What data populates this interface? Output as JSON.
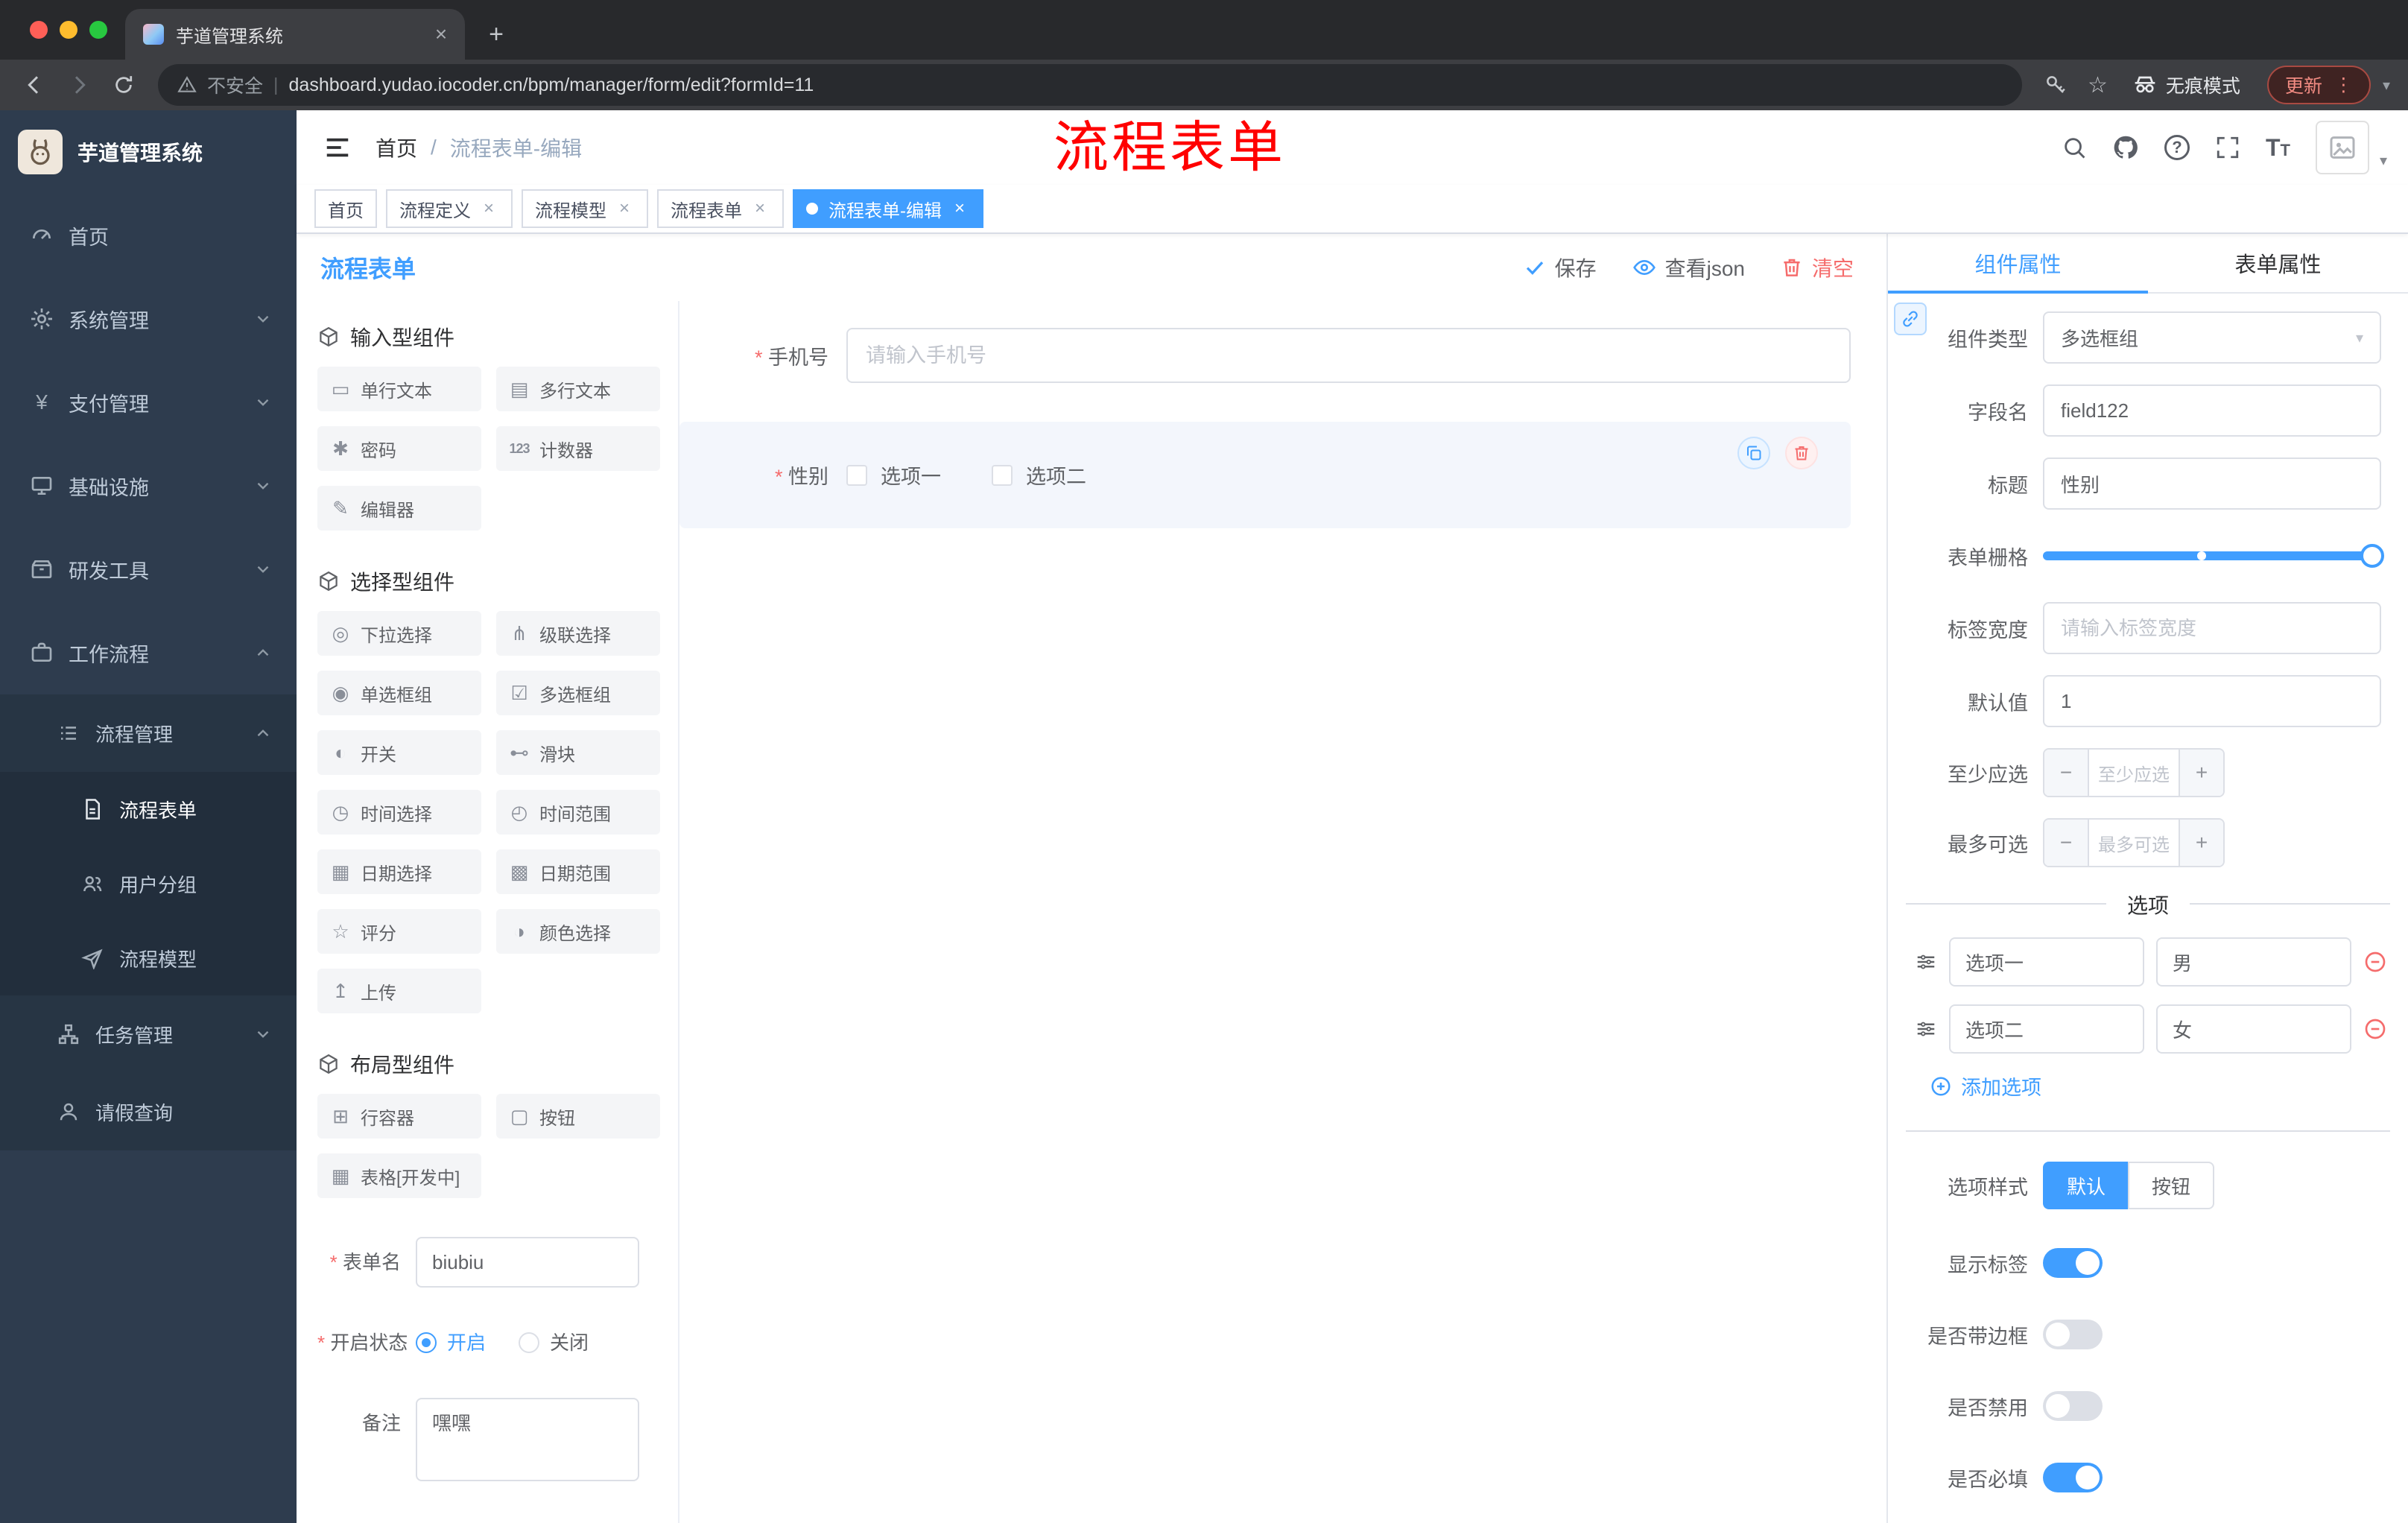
{
  "colors": {
    "accent": "#409eff",
    "danger": "#f56c6c",
    "annotation_red": "#ff0000",
    "sidebar_bg": "#2e3c4e",
    "active_tag_bg": "#409eff"
  },
  "glyphs": {
    "close": "×",
    "plus": "+",
    "minus": "−",
    "dots": "⋮",
    "slash": "/",
    "pipe": "|",
    "star": "☆",
    "caret_down": "▾"
  },
  "browser": {
    "tab_title": "芋道管理系统",
    "security_label": "不安全",
    "url": "dashboard.yudao.iocoder.cn/bpm/manager/form/edit?formId=11",
    "incognito_label": "无痕模式",
    "update_label": "更新"
  },
  "sidebar": {
    "app_title": "芋道管理系统",
    "items": [
      {
        "label": "首页"
      },
      {
        "label": "系统管理"
      },
      {
        "label": "支付管理"
      },
      {
        "label": "基础设施"
      },
      {
        "label": "研发工具"
      },
      {
        "label": "工作流程"
      },
      {
        "label": "流程管理"
      },
      {
        "label": "流程表单"
      },
      {
        "label": "用户分组"
      },
      {
        "label": "流程模型"
      },
      {
        "label": "任务管理"
      },
      {
        "label": "请假查询"
      }
    ]
  },
  "header": {
    "breadcrumb_home": "首页",
    "breadcrumb_current": "流程表单-编辑"
  },
  "annotation": "流程表单",
  "tags": {
    "items": [
      {
        "label": "首页"
      },
      {
        "label": "流程定义"
      },
      {
        "label": "流程模型"
      },
      {
        "label": "流程表单"
      },
      {
        "label": "流程表单-编辑"
      }
    ]
  },
  "designer": {
    "title": "流程表单",
    "toolbar": {
      "save": "保存",
      "view_json": "查看json",
      "clear": "清空"
    },
    "palette": {
      "sections": [
        {
          "title": "输入型组件",
          "items": [
            {
              "icon": "▭",
              "label": "单行文本"
            },
            {
              "icon": "▤",
              "label": "多行文本"
            },
            {
              "icon": "✱",
              "label": "密码"
            },
            {
              "icon": "123",
              "label": "计数器"
            },
            {
              "icon": "✎",
              "label": "编辑器"
            }
          ]
        },
        {
          "title": "选择型组件",
          "items": [
            {
              "icon": "◎",
              "label": "下拉选择"
            },
            {
              "icon": "⋔",
              "label": "级联选择"
            },
            {
              "icon": "◉",
              "label": "单选框组"
            },
            {
              "icon": "☑",
              "label": "多选框组"
            },
            {
              "icon": "◐",
              "label": "开关"
            },
            {
              "icon": "⊷",
              "label": "滑块"
            },
            {
              "icon": "◷",
              "label": "时间选择"
            },
            {
              "icon": "◴",
              "label": "时间范围"
            },
            {
              "icon": "▦",
              "label": "日期选择"
            },
            {
              "icon": "▩",
              "label": "日期范围"
            },
            {
              "icon": "☆",
              "label": "评分"
            },
            {
              "icon": "◑",
              "label": "颜色选择"
            },
            {
              "icon": "↥",
              "label": "上传"
            }
          ]
        },
        {
          "title": "布局型组件",
          "items": [
            {
              "icon": "⊞",
              "label": "行容器"
            },
            {
              "icon": "▢",
              "label": "按钮"
            },
            {
              "icon": "▦",
              "label": "表格[开发中]"
            }
          ]
        }
      ]
    },
    "meta": {
      "name_label": "表单名",
      "name_value": "biubiu",
      "status_label": "开启状态",
      "status_on": "开启",
      "status_off": "关闭",
      "remark_label": "备注",
      "remark_value": "嘿嘿"
    },
    "canvas": {
      "phone_label": "手机号",
      "phone_placeholder": "请输入手机号",
      "gender_label": "性别",
      "gender_option1": "选项一",
      "gender_option2": "选项二"
    }
  },
  "props": {
    "tab_component": "组件属性",
    "tab_form": "表单属性",
    "type_label": "组件类型",
    "type_value": "多选框组",
    "field_label": "字段名",
    "field_value": "field122",
    "title_label": "标题",
    "title_value": "性别",
    "grid_label": "表单栅格",
    "width_label": "标签宽度",
    "width_placeholder": "请输入标签宽度",
    "default_label": "默认值",
    "default_value": "1",
    "min_label": "至少应选",
    "min_placeholder": "至少应选",
    "max_label": "最多可选",
    "max_placeholder": "最多可选",
    "options_divider": "选项",
    "option_rows": [
      {
        "label": "选项一",
        "value": "男"
      },
      {
        "label": "选项二",
        "value": "女"
      }
    ],
    "add_option": "添加选项",
    "style_label": "选项样式",
    "style_default": "默认",
    "style_button": "按钮",
    "switch_show_label": "显示标签",
    "switch_border": "是否带边框",
    "switch_disabled": "是否禁用",
    "switch_required": "是否必填"
  }
}
